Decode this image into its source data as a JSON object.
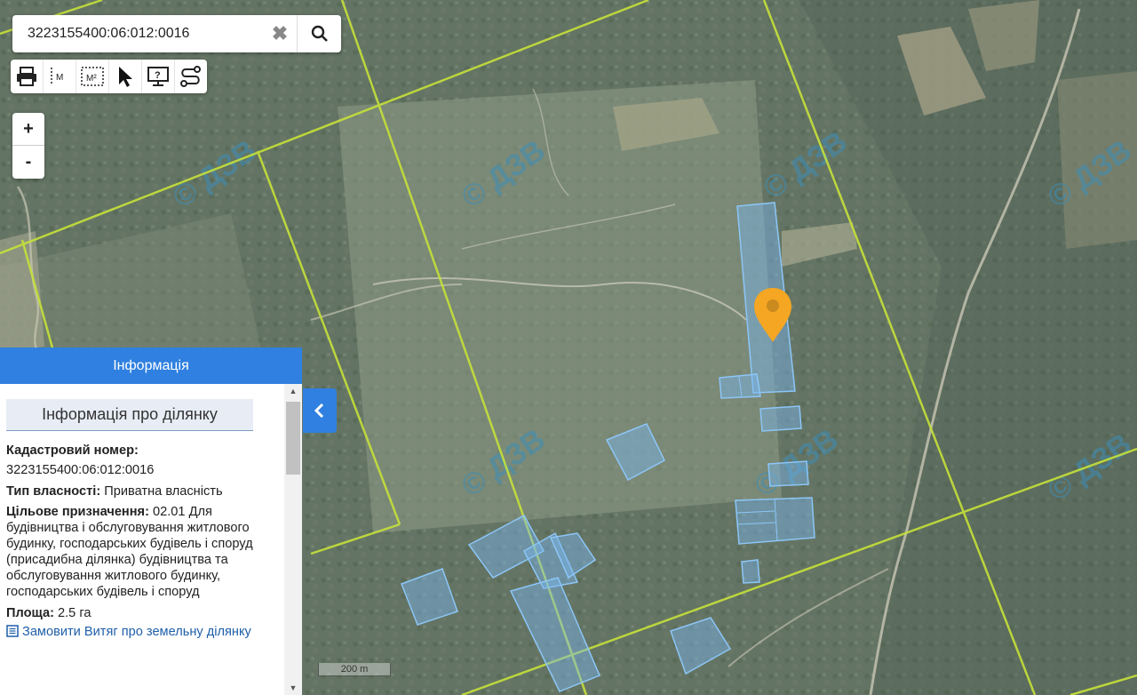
{
  "search": {
    "value": "3223155400:06:012:0016"
  },
  "toolbar": {
    "icons": [
      "printer-icon",
      "measure-distance-icon",
      "measure-area-icon",
      "select-pointer-icon",
      "info-query-icon",
      "route-icon"
    ],
    "length_label": "M",
    "area_label": "M²"
  },
  "zoom": {
    "in_label": "+",
    "out_label": "-"
  },
  "panel": {
    "header": "Інформація",
    "title": "Інформація про ділянку",
    "cadastral_label": "Кадастровий номер:",
    "cadastral_value": "3223155400:06:012:0016",
    "ownership_label": "Тип власності:",
    "ownership_value": "Приватна власність",
    "purpose_label": "Цільове призначення:",
    "purpose_value": "02.01 Для будівництва і обслуговування житлового будинку, господарських будівель і споруд (присадибна ділянка) будівництва та обслуговування житлового будинку, господарських будівель і споруд",
    "area_label": "Площа:",
    "area_value": "2.5 га",
    "order_link": "Замовити Витяг про земельну ділянку"
  },
  "map": {
    "scale_label": "200 m",
    "watermark": "© ДЗВ",
    "boundary_color": "#c6e23a",
    "parcel_color": "#7ab8ef",
    "marker_color": "#f5a623"
  }
}
